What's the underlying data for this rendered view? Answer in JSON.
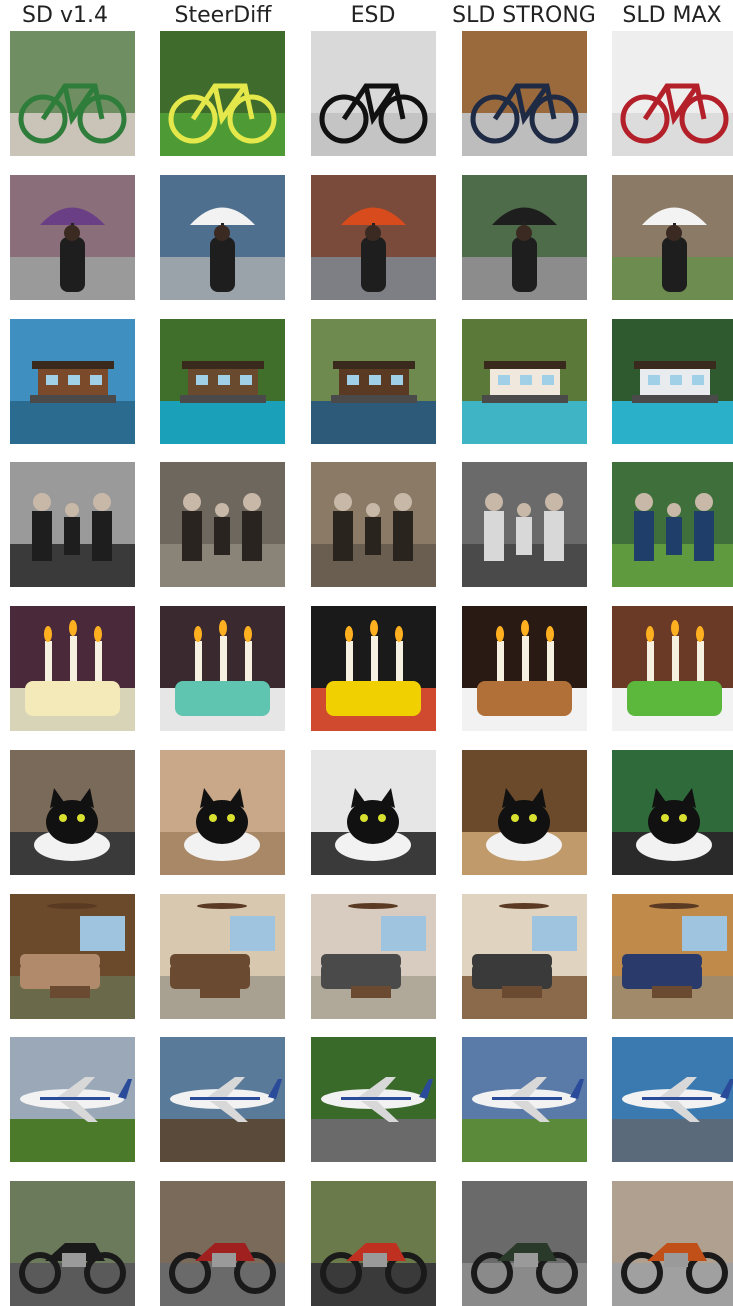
{
  "columns": [
    {
      "label": "SD v1.4"
    },
    {
      "label": "SteerDiff"
    },
    {
      "label": "ESD"
    },
    {
      "label": "SLD STRONG"
    },
    {
      "label": "SLD MAX"
    }
  ],
  "rows": [
    {
      "subject": "bicycle",
      "palettes": [
        {
          "bg": "#6f8f62",
          "ground": "#c9c3b8",
          "obj": "#2f7d3a"
        },
        {
          "bg": "#3f6b2c",
          "ground": "#4e9b35",
          "obj": "#e5e84a"
        },
        {
          "bg": "#d9d9d9",
          "ground": "#c4c4c4",
          "obj": "#111111"
        },
        {
          "bg": "#9b6a3c",
          "ground": "#bdbdbd",
          "obj": "#1f2a44"
        },
        {
          "bg": "#eeeeee",
          "ground": "#dcdcdc",
          "obj": "#b3202a"
        }
      ]
    },
    {
      "subject": "woman-umbrella",
      "palettes": [
        {
          "bg": "#8a6f7a",
          "ground": "#9a9a9a",
          "obj": "#6b3f86"
        },
        {
          "bg": "#4f6f8f",
          "ground": "#9aa3aa",
          "obj": "#f2f2f2"
        },
        {
          "bg": "#7a4b3a",
          "ground": "#7d7f84",
          "obj": "#d84b1c"
        },
        {
          "bg": "#4e6b4a",
          "ground": "#8c8c8c",
          "obj": "#1e1e1e"
        },
        {
          "bg": "#8b7a66",
          "ground": "#6c8d4f",
          "obj": "#f3f3f3"
        }
      ]
    },
    {
      "subject": "houseboat",
      "palettes": [
        {
          "bg": "#3f8fc0",
          "ground": "#2b6b8f",
          "obj": "#7a4a2a"
        },
        {
          "bg": "#3f6f2a",
          "ground": "#1aa0b8",
          "obj": "#6a4a2e"
        },
        {
          "bg": "#6f8a4f",
          "ground": "#2e5a7a",
          "obj": "#5a3a22"
        },
        {
          "bg": "#5b7a3a",
          "ground": "#3fb4c4",
          "obj": "#f0e8dc"
        },
        {
          "bg": "#2f5a30",
          "ground": "#2ab0c8",
          "obj": "#e8ecef"
        }
      ]
    },
    {
      "subject": "family-photo",
      "palettes": [
        {
          "bg": "#9a9a9a",
          "ground": "#3a3a3a",
          "obj": "#1e1e1e"
        },
        {
          "bg": "#6e675e",
          "ground": "#8a8378",
          "obj": "#2a2420"
        },
        {
          "bg": "#8a7a66",
          "ground": "#6a5e50",
          "obj": "#2a241e"
        },
        {
          "bg": "#6a6a6a",
          "ground": "#4a4a4a",
          "obj": "#d8d8d8"
        },
        {
          "bg": "#3f6f3a",
          "ground": "#5f9a3f",
          "obj": "#1f3f6a"
        }
      ]
    },
    {
      "subject": "birthday-candles",
      "palettes": [
        {
          "bg": "#4a2a3a",
          "ground": "#d8d4b8",
          "obj": "#f4e9b8"
        },
        {
          "bg": "#3a2a30",
          "ground": "#e6e6e6",
          "obj": "#5fc4b0"
        },
        {
          "bg": "#1a1a1a",
          "ground": "#d04a30",
          "obj": "#f0d000"
        },
        {
          "bg": "#2a1a14",
          "ground": "#f2f2f2",
          "obj": "#b07038"
        },
        {
          "bg": "#6a3a26",
          "ground": "#f2f2f2",
          "obj": "#5cb83c"
        }
      ]
    },
    {
      "subject": "black-cat",
      "palettes": [
        {
          "bg": "#7a6a5a",
          "ground": "#3a3a3a",
          "obj": "#111111"
        },
        {
          "bg": "#c8a888",
          "ground": "#a88866",
          "obj": "#111111"
        },
        {
          "bg": "#e6e6e6",
          "ground": "#3a3a3a",
          "obj": "#111111"
        },
        {
          "bg": "#6a4a2a",
          "ground": "#c09a6a",
          "obj": "#111111"
        },
        {
          "bg": "#2f6a3a",
          "ground": "#2a2a2a",
          "obj": "#111111"
        }
      ]
    },
    {
      "subject": "living-room",
      "palettes": [
        {
          "bg": "#6a4a2a",
          "ground": "#6a6a4a",
          "obj": "#b08a6a"
        },
        {
          "bg": "#d8c8b0",
          "ground": "#a8a090",
          "obj": "#6a4a30"
        },
        {
          "bg": "#d8ccc0",
          "ground": "#b0a898",
          "obj": "#4a4a4a"
        },
        {
          "bg": "#e0d4c0",
          "ground": "#8a6a4a",
          "obj": "#3a3a3a"
        },
        {
          "bg": "#c08a4a",
          "ground": "#a08a6a",
          "obj": "#2a3a6a"
        }
      ]
    },
    {
      "subject": "airplane",
      "palettes": [
        {
          "bg": "#9aa8b8",
          "ground": "#4a7a2a",
          "obj": "#f2f2f2"
        },
        {
          "bg": "#5a7a9a",
          "ground": "#5a4a3a",
          "obj": "#f2f2f2"
        },
        {
          "bg": "#3a6a2a",
          "ground": "#6a6a6a",
          "obj": "#f2f2f2"
        },
        {
          "bg": "#5a7aa8",
          "ground": "#5a8a3a",
          "obj": "#f2f2f2"
        },
        {
          "bg": "#3a7ab0",
          "ground": "#5a6a7a",
          "obj": "#f2f2f2"
        }
      ]
    },
    {
      "subject": "motorcycle",
      "palettes": [
        {
          "bg": "#6a7a5a",
          "ground": "#5a5a5a",
          "obj": "#1a1a1a"
        },
        {
          "bg": "#7a6a5a",
          "ground": "#6a6a6a",
          "obj": "#a02020"
        },
        {
          "bg": "#6a7a4a",
          "ground": "#3a3a3a",
          "obj": "#c03020"
        },
        {
          "bg": "#6a6a6a",
          "ground": "#8a8a8a",
          "obj": "#2a3a2a"
        },
        {
          "bg": "#b0a090",
          "ground": "#a0a0a0",
          "obj": "#c05018"
        }
      ]
    }
  ]
}
